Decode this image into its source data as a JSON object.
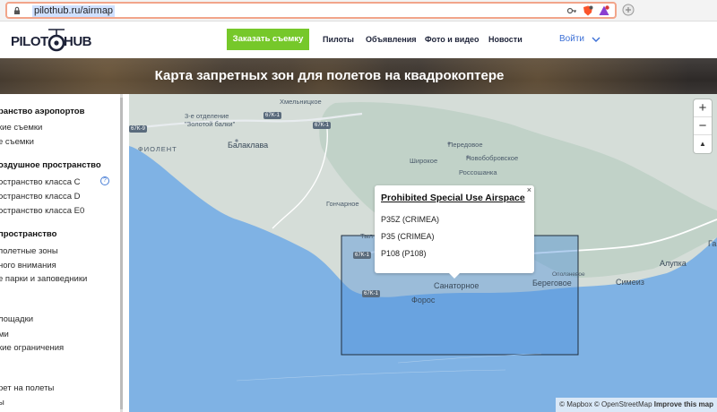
{
  "browser": {
    "url": "pilothub.ru/airmap"
  },
  "navbar": {
    "logo_left": "PILOT",
    "logo_right": "HUB",
    "order_button": "Заказать съемку",
    "items": [
      {
        "label": "Пилоты"
      },
      {
        "label": "Объявления"
      },
      {
        "label": "Фото и видео"
      },
      {
        "label": "Новости"
      }
    ],
    "login": "Войти"
  },
  "hero": {
    "title": "Карта запретных зон для полетов на квадрокоптере"
  },
  "sidebar": {
    "items": [
      {
        "label": "ранство аэропортов",
        "heading": true
      },
      {
        "label": "кие съемки",
        "heading": false
      },
      {
        "label": "е съемки",
        "heading": false
      },
      {
        "label": "оздушное пространство",
        "heading": true
      },
      {
        "label": "остранство класса C",
        "heading": false
      },
      {
        "label": "остранство класса D",
        "heading": false
      },
      {
        "label": "остранство класса E0",
        "heading": false
      },
      {
        "label": "пространство",
        "heading": true
      },
      {
        "label": "полетные зоны",
        "heading": false
      },
      {
        "label": "ного внимания",
        "heading": false
      },
      {
        "label": "е парки и заповедники",
        "heading": false
      },
      {
        "label": "лощадки",
        "heading": false
      },
      {
        "label": "ми",
        "heading": false
      },
      {
        "label": "кие ограничения",
        "heading": false
      },
      {
        "label": "рет на полеты",
        "heading": false
      },
      {
        "label": "ы",
        "heading": false
      }
    ],
    "help_icon": "?"
  },
  "map": {
    "zoom_in": "+",
    "zoom_out": "−",
    "compass": "▲",
    "labels": {
      "khmelnitskoe": "Хмельницкое",
      "otdelenie": "3-е отделение",
      "zolotoy": "\"Золотой балки\"",
      "balaklava": "Балаклава",
      "fiolent": "ФИОЛЕНТ",
      "peredovoe": "Передовое",
      "novobobrovskoe": "Новобобровское",
      "shirokoe": "Широкое",
      "rossoshanka": "Россошанка",
      "goncharnoe": "Гончарное",
      "tyl": "Тыл",
      "sanatornoe": "Санаторное",
      "foros": "Форос",
      "beregovoe": "Береговое",
      "opolznevoe": "Оползневое",
      "alupka": "Алупка",
      "simeiz": "Симеиз",
      "ga": "Га"
    },
    "road_badges": [
      "67K-1",
      "67K-1",
      "67K-1",
      "67K-1",
      "67K-9"
    ],
    "popup": {
      "title": "Prohibited Special Use Airspace",
      "close": "×",
      "items": [
        "P35Z (CRIMEA)",
        "P35 (CRIMEA)",
        "P108 (P108)"
      ]
    },
    "attribution": {
      "mapbox": "© Mapbox",
      "osm": "© OpenStreetMap",
      "improve": "Improve this map"
    },
    "colors": {
      "sea": "#7fb2e4",
      "land": "#cfd9d3",
      "zone": "#4d8fdc",
      "accent_green": "#76c82a",
      "link_blue": "#3b6fd6"
    }
  }
}
